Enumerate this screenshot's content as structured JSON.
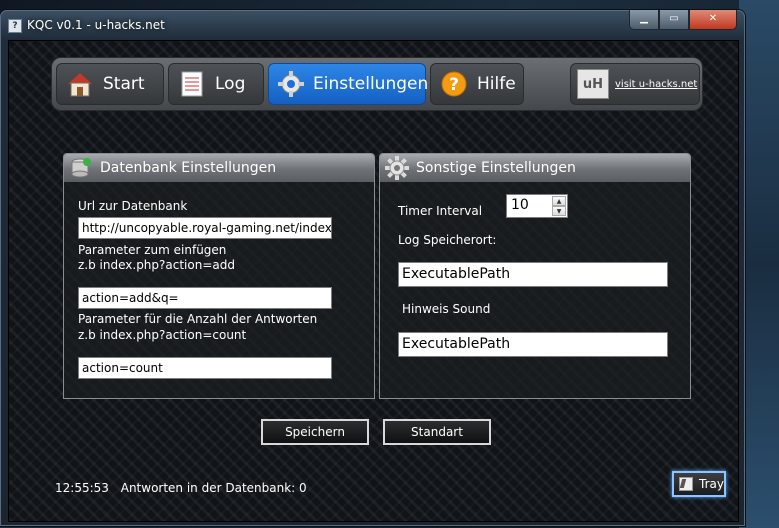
{
  "window": {
    "title": "KQC v0.1  -  u-hacks.net",
    "app_icon_glyph": "?",
    "minimize": "▁",
    "maximize": "▭",
    "close": "✕"
  },
  "nav": {
    "start": "Start",
    "log": "Log",
    "settings": "Einstellungen",
    "help": "Hilfe",
    "help_glyph": "?",
    "visit_logo": "uH",
    "visit_link": "visit u-hacks.net",
    "active": "settings"
  },
  "db_panel": {
    "title": "Datenbank Einstellungen",
    "url_label": "Url zur Datenbank",
    "url_value": "http://uncopyable.royal-gaming.net/index.pl",
    "add_label_1": "Parameter zum einfügen",
    "add_label_2": "z.b index.php?action=add",
    "add_value": "action=add&q=",
    "count_label_1": "Parameter für die Anzahl der Antworten",
    "count_label_2": "z.b index.php?action=count",
    "count_value": "action=count"
  },
  "misc_panel": {
    "title": "Sonstige Einstellungen",
    "timer_label": "Timer Interval",
    "timer_value": "10",
    "log_label": "Log Speicherort:",
    "log_value": "ExecutablePath",
    "sound_label": "Hinweis Sound",
    "sound_value": "ExecutablePath"
  },
  "buttons": {
    "save": "Speichern",
    "default": "Standart"
  },
  "status": {
    "time": "12:55:53",
    "text": "Antworten in der Datenbank: 0"
  },
  "tray": {
    "label": "Tray"
  },
  "colors": {
    "accent": "#1f6fd6",
    "tray_glow": "#8ec4ff"
  }
}
